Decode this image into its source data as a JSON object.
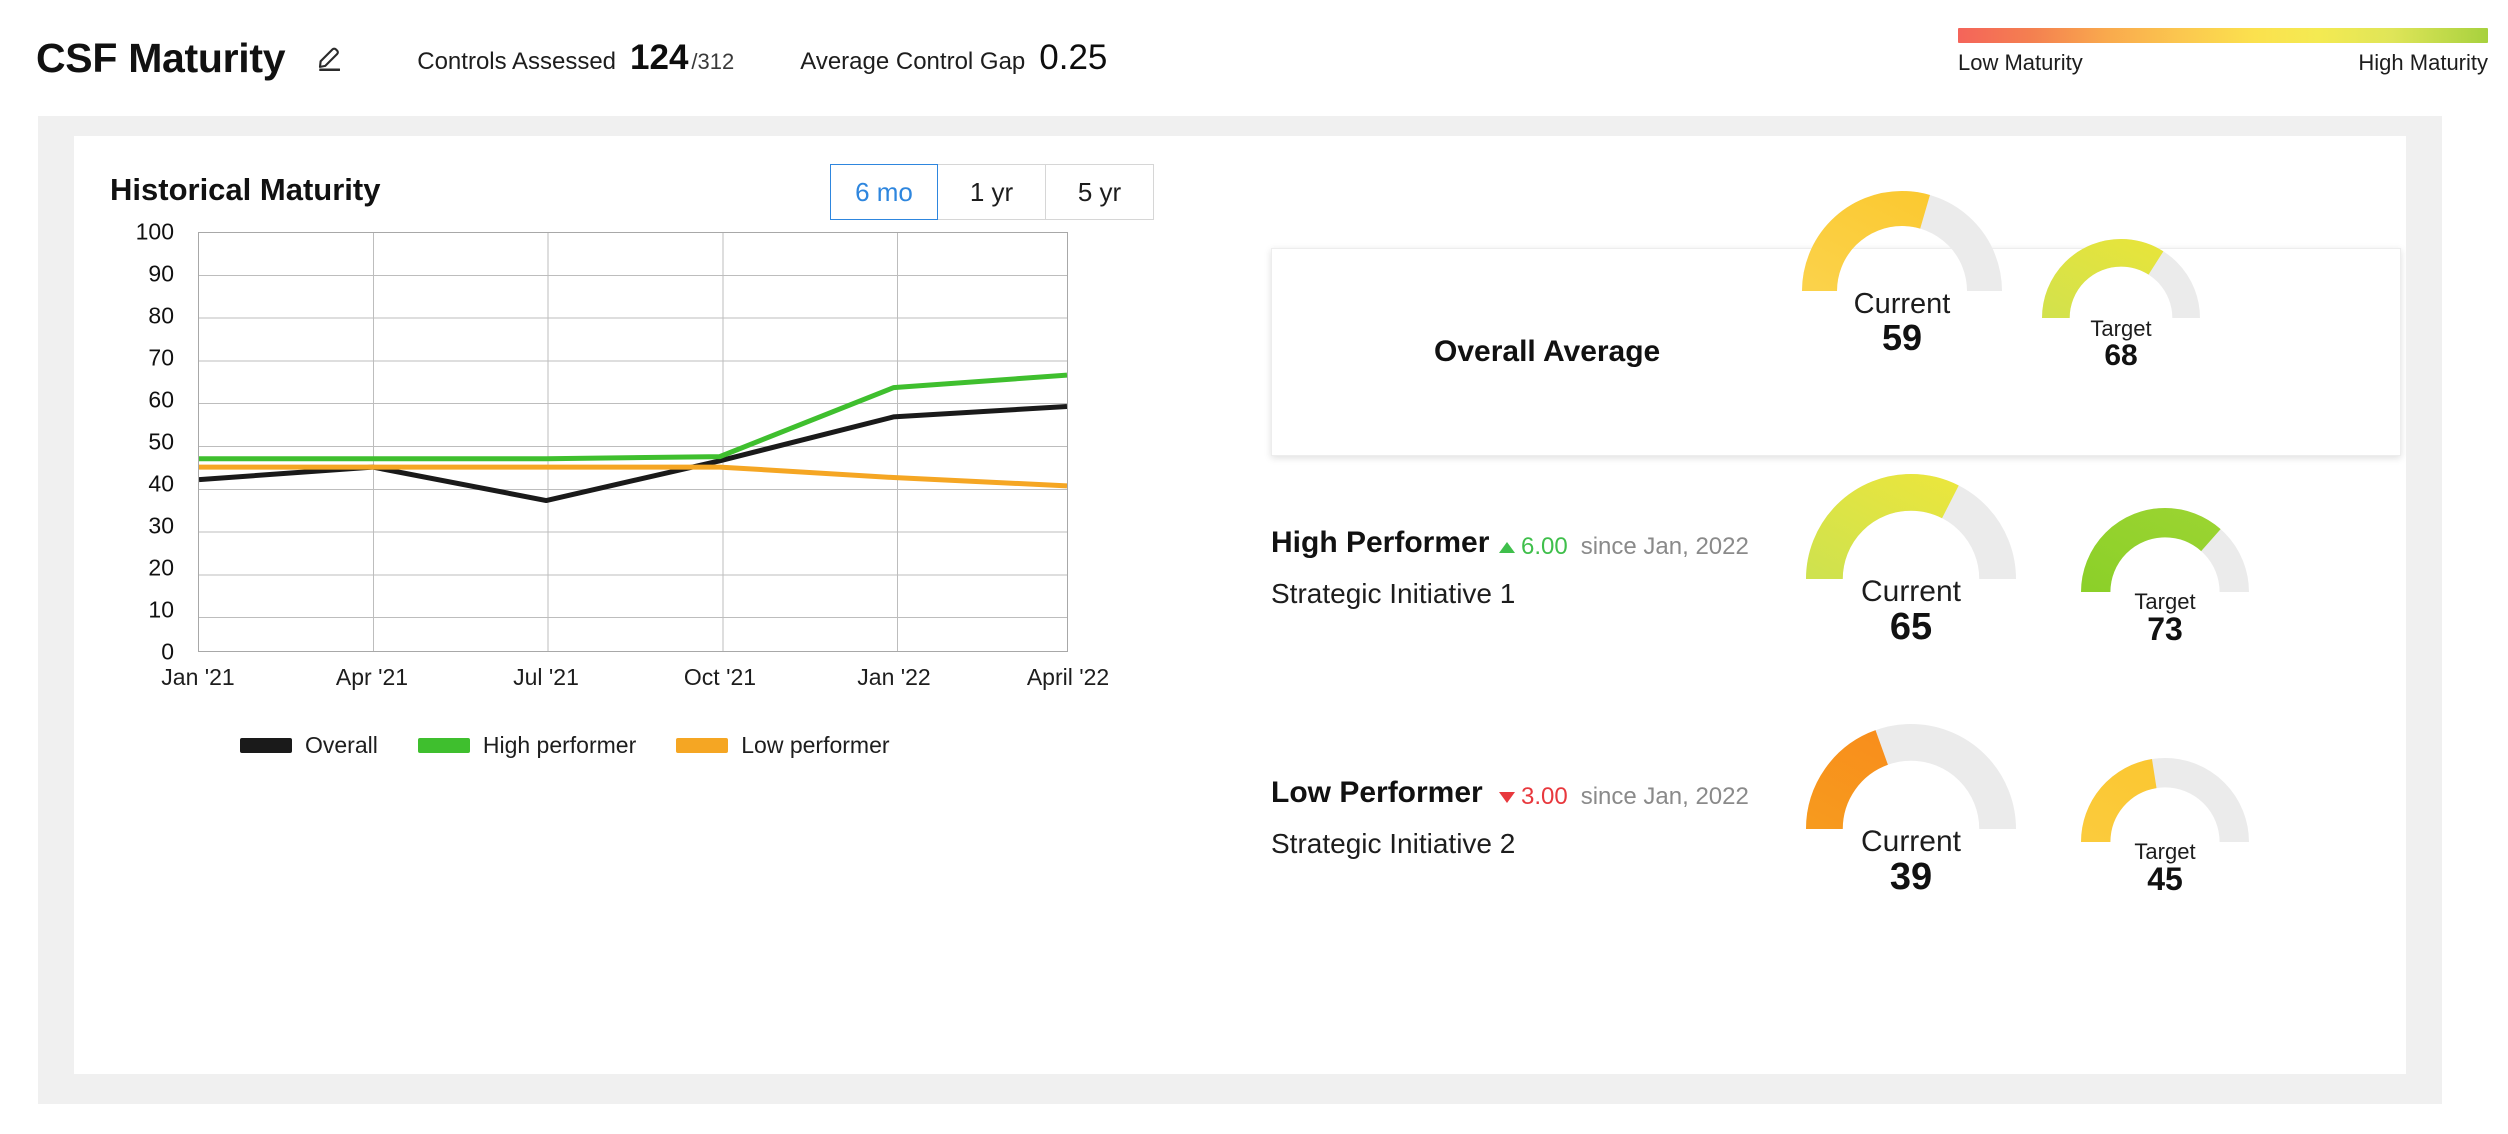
{
  "header": {
    "title": "CSF Maturity",
    "edit_icon": "pencil-edit-icon",
    "kpis": [
      {
        "label": "Controls Assessed",
        "value": "124",
        "sub": "/312"
      },
      {
        "label": "Average Control Gap",
        "value": "0.25"
      }
    ],
    "scale_legend": {
      "low_label": "Low Maturity",
      "high_label": "High Maturity",
      "gradient_stops": [
        "#f4645a",
        "#f9a94d",
        "#fbe14e",
        "#a7d13e"
      ]
    }
  },
  "chart_panel": {
    "title": "Historical Maturity",
    "range_buttons": [
      {
        "label": "6 mo",
        "selected": true
      },
      {
        "label": "1 yr",
        "selected": false
      },
      {
        "label": "5 yr",
        "selected": false
      }
    ],
    "selected_range": "6 mo",
    "active_color": "#2e86de"
  },
  "chart_data": {
    "type": "line",
    "title": "Historical Maturity",
    "xlabel": "",
    "ylabel": "",
    "ylim": [
      0,
      100
    ],
    "yticks": [
      100,
      90,
      80,
      70,
      60,
      50,
      40,
      30,
      20,
      10,
      0
    ],
    "grid": true,
    "legend_position": "bottom",
    "categories": [
      "Jan '21",
      "Apr '21",
      "Jul '21",
      "Oct '21",
      "Jan '22",
      "April '22"
    ],
    "series": [
      {
        "name": "Overall",
        "color": "#1a1a1a",
        "values": [
          41,
          44,
          36,
          45.5,
          56,
          58.5
        ]
      },
      {
        "name": "High performer",
        "color": "#3fbf2e",
        "values": [
          46,
          46,
          46,
          46.5,
          63,
          66
        ]
      },
      {
        "name": "Low performer",
        "color": "#f5a623",
        "values": [
          44,
          44,
          44,
          44,
          41.5,
          39.5
        ]
      }
    ]
  },
  "gauges_panel": {
    "overall": {
      "label": "Overall Average",
      "gauges": [
        {
          "caption": "Current",
          "value": "59",
          "percent": 59,
          "color_start": "#fbd24a",
          "color_end": "#fbc82e"
        },
        {
          "caption": "Target",
          "value": "68",
          "percent": 68,
          "color_start": "#d3e24c",
          "color_end": "#e8e43a"
        }
      ]
    },
    "performers": [
      {
        "name": "High Performer",
        "delta_direction": "up",
        "delta_value": "6.00",
        "delta_since": "since Jan, 2022",
        "initiative": "Strategic Initiative 1",
        "gauges": [
          {
            "caption": "Current",
            "value": "65",
            "percent": 65,
            "color_start": "#cfe24e",
            "color_end": "#ece63c"
          },
          {
            "caption": "Target",
            "value": "73",
            "percent": 73,
            "color_start": "#8cd029",
            "color_end": "#9bd431"
          }
        ]
      },
      {
        "name": "Low Performer",
        "delta_direction": "down",
        "delta_value": "3.00",
        "delta_since": "since Jan, 2022",
        "initiative": "Strategic Initiative 2",
        "gauges": [
          {
            "caption": "Current",
            "value": "39",
            "percent": 39,
            "color_start": "#f79a1e",
            "color_end": "#f8891a"
          },
          {
            "caption": "Target",
            "value": "45",
            "percent": 45,
            "color_start": "#fbcb3c",
            "color_end": "#fbc62f"
          }
        ]
      }
    ],
    "track_color": "#ebebeb"
  }
}
